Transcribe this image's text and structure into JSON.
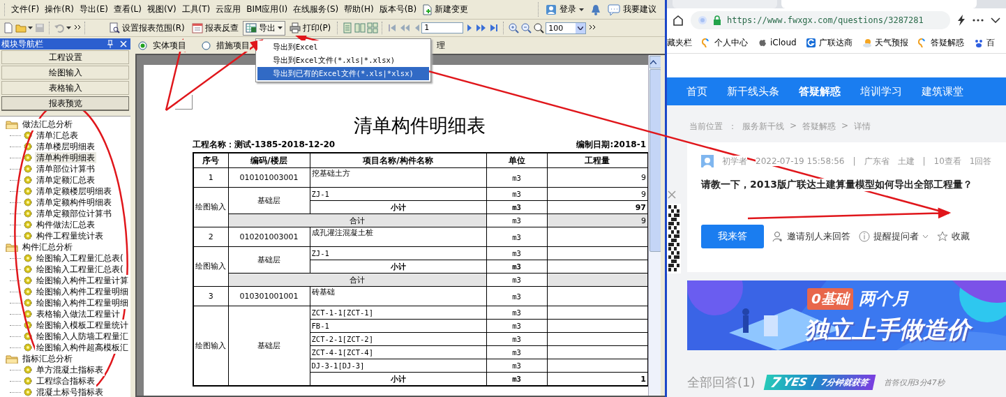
{
  "menu_bar": {
    "items": [
      "文件(F)",
      "操作(R)",
      "导出(E)",
      "查看(L)",
      "视图(V)",
      "工具(T)",
      "云应用",
      "BIM应用(I)",
      "在线服务(S)",
      "帮助(H)",
      "版本号(B)"
    ],
    "new_change": "新建变更",
    "login": "登录",
    "suggest": "我要建议"
  },
  "toolbar": {
    "range": "设置报表范围(R)",
    "reverse": "报表反查",
    "export": "导出",
    "print": "打印(P)",
    "page": "1",
    "zoom": "100"
  },
  "export_menu": [
    {
      "label": "导出到Excel",
      "selected": false
    },
    {
      "label": "导出到Excel文件(*.xls|*.xlsx)",
      "selected": false
    },
    {
      "label": "导出到已有的Excel文件(*.xls|*xlsx)",
      "selected": true
    }
  ],
  "sidebar": {
    "title": "模块导航栏",
    "sections": [
      {
        "label": "工程设置",
        "selected": false
      },
      {
        "label": "绘图输入",
        "selected": false
      },
      {
        "label": "表格输入",
        "selected": false
      },
      {
        "label": "报表预览",
        "selected": true
      }
    ],
    "tree": [
      {
        "label": "做法汇总分析",
        "expanded": true,
        "children": [
          {
            "label": "清单汇总表",
            "selected": false
          },
          {
            "label": "清单楼层明细表",
            "selected": false
          },
          {
            "label": "清单构件明细表",
            "selected": true
          },
          {
            "label": "清单部位计算书",
            "selected": false
          },
          {
            "label": "清单定额汇总表",
            "selected": false
          },
          {
            "label": "清单定额楼层明细表",
            "selected": false
          },
          {
            "label": "清单定额构件明细表",
            "selected": false
          },
          {
            "label": "清单定额部位计算书",
            "selected": false
          },
          {
            "label": "构件做法汇总表",
            "selected": false
          },
          {
            "label": "构件工程量统计表",
            "selected": false
          }
        ]
      },
      {
        "label": "构件汇总分析",
        "expanded": true,
        "children": [
          {
            "label": "绘图输入工程量汇总表(",
            "selected": false
          },
          {
            "label": "绘图输入工程量汇总表(",
            "selected": false
          },
          {
            "label": "绘图输入构件工程量计算",
            "selected": false
          },
          {
            "label": "绘图输入构件工程量明细",
            "selected": false
          },
          {
            "label": "绘图输入构件工程量明细",
            "selected": false
          },
          {
            "label": "表格输入做法工程量计",
            "selected": false
          },
          {
            "label": "绘图输入模板工程量统计",
            "selected": false
          },
          {
            "label": "绘图输入人防墙工程量汇",
            "selected": false
          },
          {
            "label": "绘图输入构件超高模板汇",
            "selected": false
          }
        ]
      },
      {
        "label": "指标汇总分析",
        "expanded": true,
        "children": [
          {
            "label": "单方混凝土指标表",
            "selected": false
          },
          {
            "label": "工程综合指标表",
            "selected": false
          },
          {
            "label": "混凝土标号指标表",
            "selected": false
          }
        ]
      }
    ]
  },
  "radio_bar": {
    "options": [
      {
        "label": "实体项目",
        "selected": true
      },
      {
        "label": "措施项目",
        "selected": false
      }
    ],
    "cut_label": "理"
  },
  "report": {
    "title": "清单构件明细表",
    "project": "工程名称：测试-1385-2018-12-20",
    "date": "编制日期:2018-1",
    "columns": [
      "序号",
      "编码/楼层",
      "项目名称/构件名称",
      "单位",
      "工程量"
    ],
    "items": [
      {
        "no": "1",
        "code": "010101003001",
        "name": "挖基础土方",
        "unit": "m3",
        "qty": "9",
        "source": "绘图输入",
        "floor": "基础层",
        "parts": [
          {
            "name": "ZJ-1",
            "unit": "m3",
            "qty": "9"
          }
        ],
        "subtotal": {
          "label": "小计",
          "unit": "m3",
          "qty": "97"
        },
        "total": {
          "label": "合计",
          "unit": "m3",
          "qty": "9"
        }
      },
      {
        "no": "2",
        "code": "010201003001",
        "name": "成孔灌注混凝土桩",
        "unit": "m3",
        "source": "绘图输入",
        "floor": "基础层",
        "parts": [
          {
            "name": "ZJ-1",
            "unit": "m3"
          }
        ],
        "subtotal": {
          "label": "小计",
          "unit": "m3"
        },
        "total": {
          "label": "合计",
          "unit": "m3"
        }
      },
      {
        "no": "3",
        "code": "010301001001",
        "name": "砖基础",
        "unit": "m3",
        "source": "绘图输入",
        "floor": "基础层",
        "parts": [
          {
            "name": "ZCT-1-1[ZCT-1]",
            "unit": "m3"
          },
          {
            "name": "FB-1",
            "unit": "m3"
          },
          {
            "name": "ZCT-2-1[ZCT-2]",
            "unit": "m3"
          },
          {
            "name": "ZCT-4-1[ZCT-4]",
            "unit": "m3"
          },
          {
            "name": "DJ-3-1[DJ-3]",
            "unit": "m3"
          }
        ],
        "subtotal": {
          "label": "小计",
          "unit": "m3",
          "qty": "1"
        }
      }
    ]
  },
  "browser": {
    "url": "https://www.fwxgx.com/questions/3287281",
    "bookmarks": [
      "藏夹栏",
      "个人中心",
      "iCloud",
      "广联达商",
      "天气预报",
      "答疑解惑",
      "百"
    ],
    "nav": [
      {
        "label": "首页",
        "selected": false
      },
      {
        "label": "新干线头条",
        "selected": false
      },
      {
        "label": "答疑解惑",
        "selected": true
      },
      {
        "label": "培训学习",
        "selected": false
      },
      {
        "label": "建筑课堂",
        "selected": false
      }
    ],
    "breadcrumb": {
      "label": "当前位置",
      "colon": "：",
      "separator": ">",
      "path": [
        "服务新干线",
        "答疑解惑",
        "详情"
      ]
    },
    "question": {
      "author": "初学者",
      "time": "2022-07-19 15:58:56",
      "divider": "|",
      "region": "广东省",
      "category": "土建",
      "views": "10查看",
      "answers": "1回答",
      "title": "请教一下，2013版广联达土建算量模型如何导出全部工程量？",
      "answer_button": "我来答",
      "invite": "邀请别人来回答",
      "remind": "提醒提问者",
      "favorite": "收藏"
    },
    "banner": {
      "tag": "0基础",
      "line1": "两个月",
      "line2": "独立上手做造价"
    },
    "answers": {
      "heading": "全部回答(1)",
      "badge_number": "7",
      "badge_word": "YES！",
      "badge_text": "7分钟就获答",
      "note": "首答仅用3分47秒"
    }
  }
}
